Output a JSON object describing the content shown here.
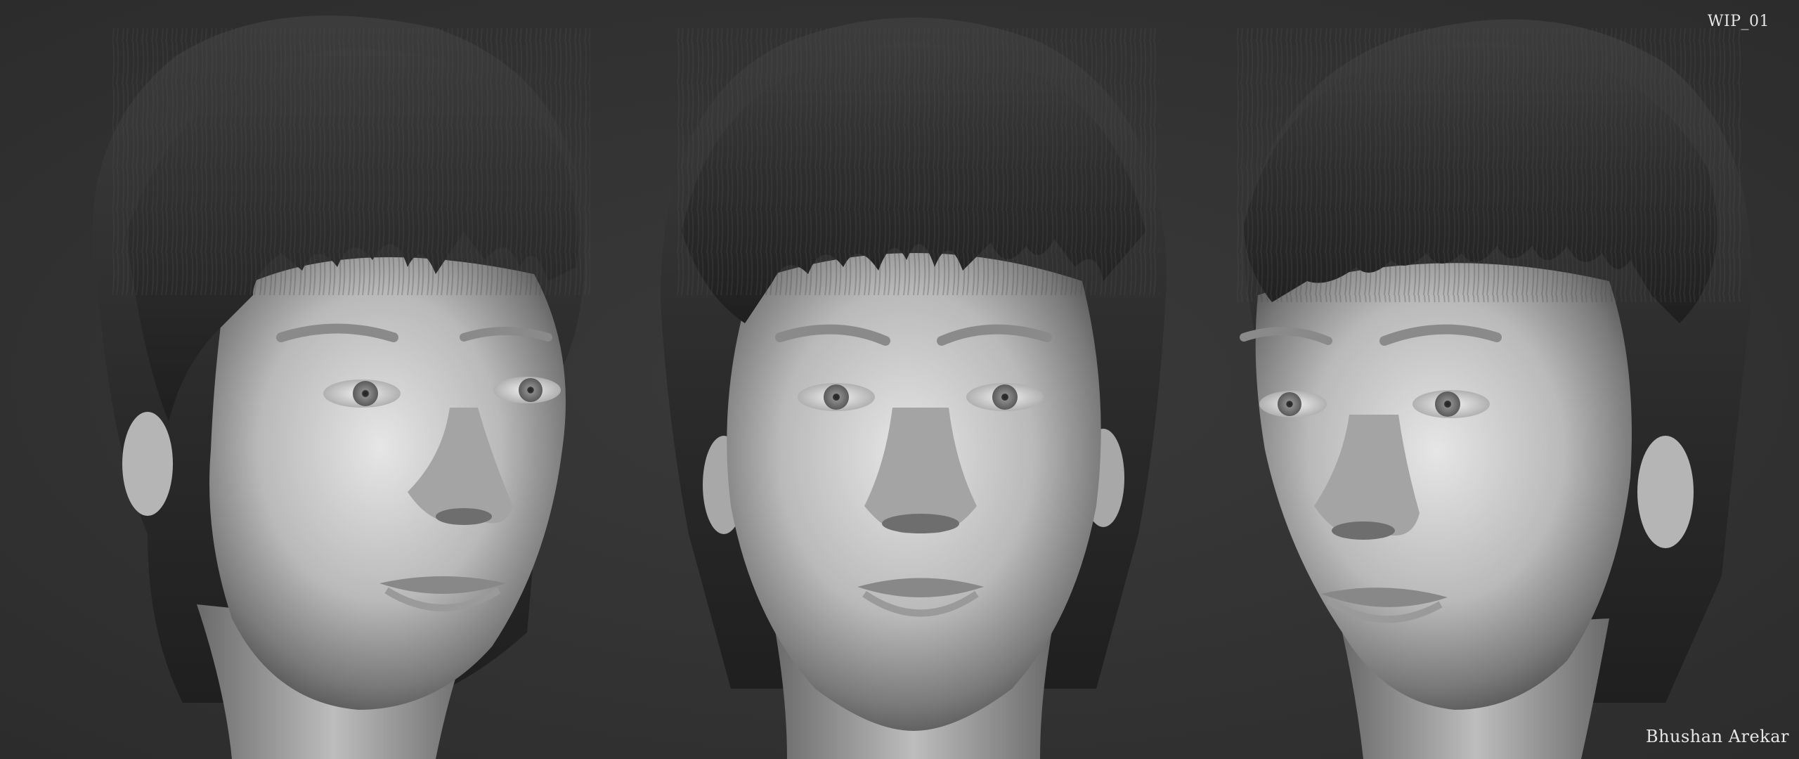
{
  "labels": {
    "wip": "WIP_01",
    "credit": "Bhushan Arekar"
  },
  "views": [
    "left-three-quarter",
    "front",
    "right-three-quarter"
  ],
  "colors": {
    "background": "#323232",
    "skin_light": "#e2e2e2",
    "skin_mid": "#a8a8a8",
    "skin_dark": "#555555",
    "hair": "#2a2a2a",
    "hair_highlight": "#4a4a4a",
    "iris": "#9a9a9a",
    "text": "#e6e6e6"
  }
}
